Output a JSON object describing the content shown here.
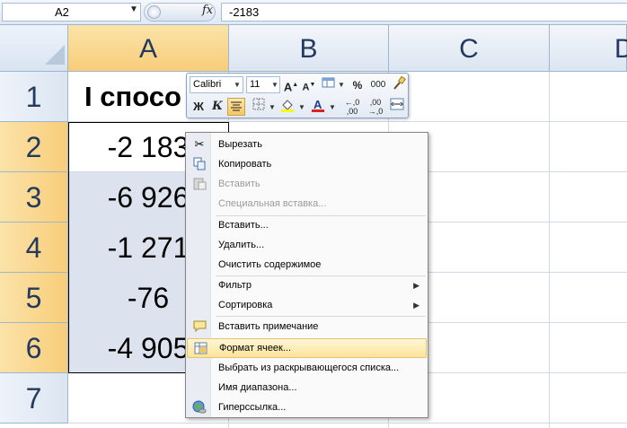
{
  "formula_bar": {
    "name_box": "A2",
    "fx_label": "fx",
    "formula": "-2183"
  },
  "columns": [
    "A",
    "B",
    "C",
    "D"
  ],
  "rows": [
    "1",
    "2",
    "3",
    "4",
    "5",
    "6",
    "7"
  ],
  "cells": {
    "a1": "I спосо",
    "a2": "-2 183",
    "a3": "-6 926",
    "a4": "-1 271",
    "a5": "-76",
    "a6": "-4 905"
  },
  "mini_toolbar": {
    "font_name": "Calibri",
    "font_size": "11",
    "percent": "%",
    "thousands": "000",
    "bold": "Ж",
    "italic": "К"
  },
  "context_menu": {
    "cut": "Вырезать",
    "copy": "Копировать",
    "paste": "Вставить",
    "paste_special": "Специальная вставка...",
    "insert": "Вставить...",
    "delete": "Удалить...",
    "clear_contents": "Очистить содержимое",
    "filter": "Фильтр",
    "sort": "Сортировка",
    "insert_comment": "Вставить примечание",
    "format_cells": "Формат ячеек...",
    "pick_from_list": "Выбрать из раскрывающегося списка...",
    "name_range": "Имя диапазона...",
    "hyperlink": "Гиперссылка..."
  },
  "colors": {
    "selection_header": "#f8cd7a",
    "header_text": "#233a5e",
    "menu_hover": "#fde49b"
  }
}
